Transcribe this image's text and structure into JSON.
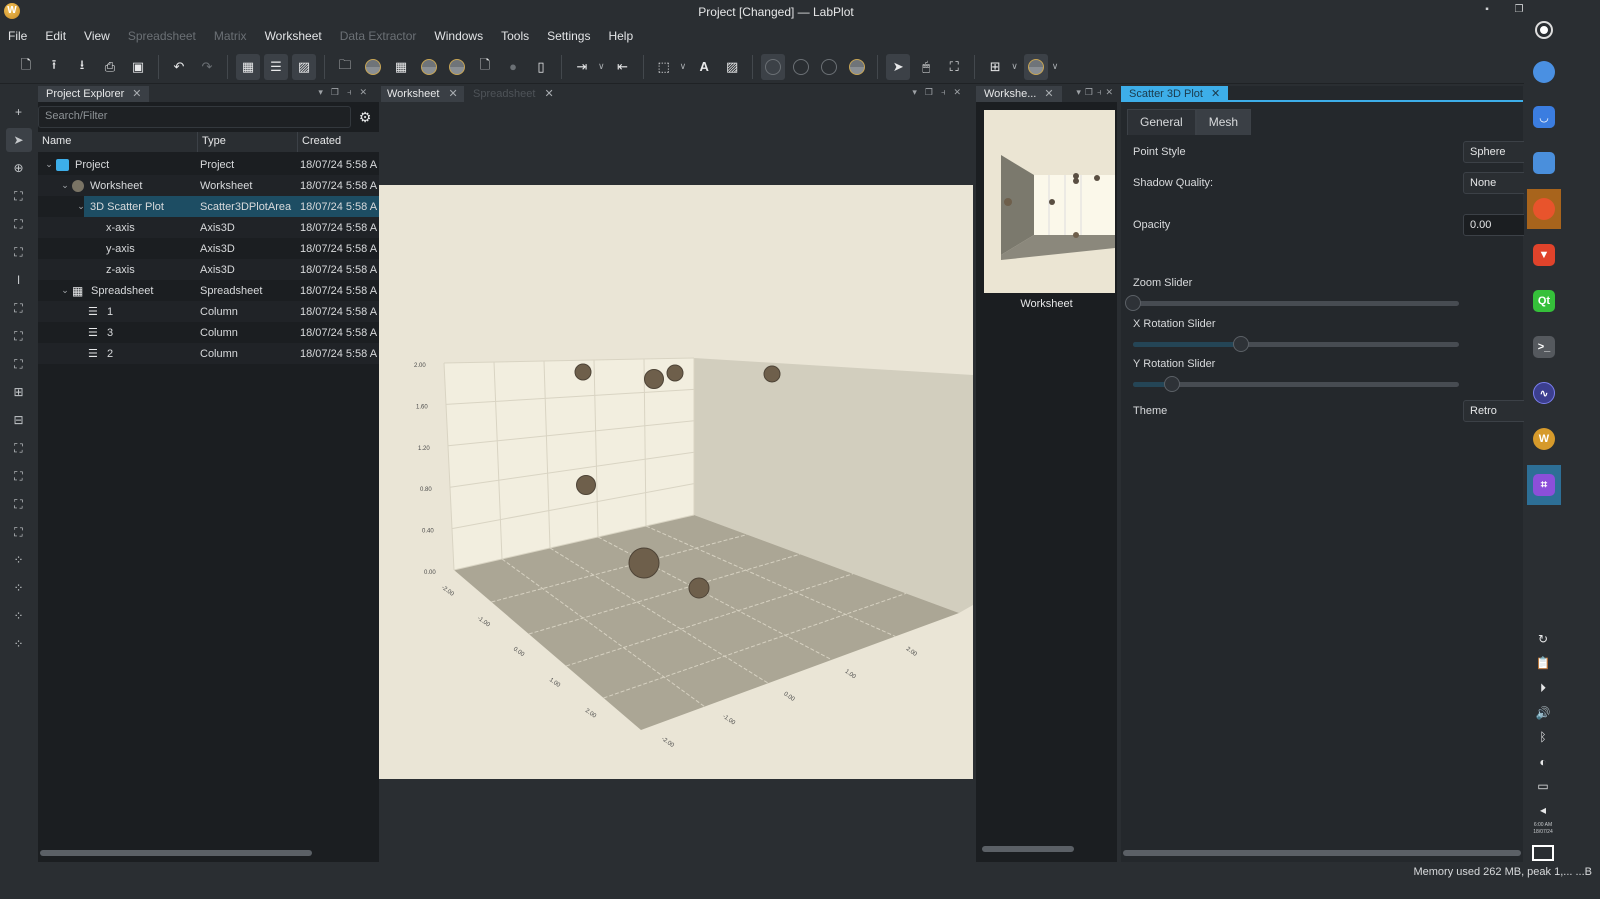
{
  "window": {
    "title": "Project [Changed] — LabPlot",
    "app_icon": "labplot-logo"
  },
  "menu": [
    {
      "label": "File",
      "enabled": true
    },
    {
      "label": "Edit",
      "enabled": true
    },
    {
      "label": "View",
      "enabled": true
    },
    {
      "label": "Spreadsheet",
      "enabled": false
    },
    {
      "label": "Matrix",
      "enabled": false
    },
    {
      "label": "Worksheet",
      "enabled": true
    },
    {
      "label": "Data Extractor",
      "enabled": false
    },
    {
      "label": "Windows",
      "enabled": true
    },
    {
      "label": "Tools",
      "enabled": true
    },
    {
      "label": "Settings",
      "enabled": true
    },
    {
      "label": "Help",
      "enabled": true
    }
  ],
  "toolbar": {
    "icons": [
      "new-document-icon",
      "import-icon",
      "export-icon",
      "print-icon",
      "archive-icon",
      "undo-icon",
      "redo-icon",
      "grid-view-icon",
      "list-view-icon",
      "image-view-icon",
      "open-folder-icon",
      "worksheet-icon",
      "spreadsheet-add-icon",
      "worksheet-icon",
      "worksheet-icon",
      "add-note-icon",
      "drop-icon",
      "page-icon",
      "export-layout-icon",
      "layout-icon",
      "plot-area-icon",
      "text-label-icon",
      "image-icon",
      "plot-type-icon",
      "plot-type-icon",
      "plot-type-icon",
      "plot-type-icon",
      "select-cursor-icon",
      "mouse-mode-icon",
      "fit-icon",
      "add-element-icon",
      "worksheet-theme-icon"
    ]
  },
  "project_explorer": {
    "title": "Project Explorer",
    "search_placeholder": "Search/Filter",
    "columns": [
      "Name",
      "Type",
      "Created"
    ],
    "rows": [
      {
        "name": "Project",
        "type": "Project",
        "created": "18/07/24 5:58 A",
        "icon": "folder-icon",
        "level": 0,
        "expanded": true
      },
      {
        "name": "Worksheet",
        "type": "Worksheet",
        "created": "18/07/24 5:58 A",
        "icon": "worksheet-icon",
        "level": 1,
        "expanded": true
      },
      {
        "name": "3D Scatter Plot",
        "type": "Scatter3DPlotArea",
        "created": "18/07/24 5:58 A",
        "icon": "",
        "level": 2,
        "expanded": true,
        "selected": true
      },
      {
        "name": "x-axis",
        "type": "Axis3D",
        "created": "18/07/24 5:58 A",
        "icon": "",
        "level": 3
      },
      {
        "name": "y-axis",
        "type": "Axis3D",
        "created": "18/07/24 5:58 A",
        "icon": "",
        "level": 3
      },
      {
        "name": "z-axis",
        "type": "Axis3D",
        "created": "18/07/24 5:58 A",
        "icon": "",
        "level": 3
      },
      {
        "name": "Spreadsheet",
        "type": "Spreadsheet",
        "created": "18/07/24 5:58 A",
        "icon": "spreadsheet-icon",
        "level": 1,
        "expanded": true
      },
      {
        "name": "1",
        "type": "Column",
        "created": "18/07/24 5:58 A",
        "icon": "column-icon",
        "level": 2
      },
      {
        "name": "3",
        "type": "Column",
        "created": "18/07/24 5:58 A",
        "icon": "column-icon",
        "level": 2
      },
      {
        "name": "2",
        "type": "Column",
        "created": "18/07/24 5:58 A",
        "icon": "column-icon",
        "level": 2
      }
    ]
  },
  "center_tabs": [
    {
      "label": "Worksheet",
      "active": true
    },
    {
      "label": "Spreadsheet",
      "active": false
    }
  ],
  "plot": {
    "y_tick_labels": [
      "2.00",
      "1.60",
      "1.20",
      "0.80",
      "0.40",
      "0.00"
    ],
    "x_tick_labels": [
      "-2.00",
      "-1.00",
      "0.00",
      "1.00",
      "2.00"
    ],
    "z_tick_labels": [
      "-2.00",
      "-1.00",
      "0.00",
      "1.00",
      "2.00"
    ],
    "background_color": "#eae5d6",
    "point_color": "#6e5f4b"
  },
  "preview": {
    "tab_label": "Workshe...",
    "caption": "Worksheet"
  },
  "properties": {
    "tab_label": "Scatter 3D Plot",
    "subtabs": [
      {
        "label": "General",
        "active": false
      },
      {
        "label": "Mesh",
        "active": true
      }
    ],
    "point_style": {
      "label": "Point Style",
      "value": "Sphere"
    },
    "shadow_quality": {
      "label": "Shadow Quality:",
      "value": "None"
    },
    "opacity": {
      "label": "Opacity",
      "value": "0.00"
    },
    "zoom_slider": {
      "label": "Zoom Slider",
      "value": 0.0
    },
    "x_rotation_slider": {
      "label": "X Rotation Slider",
      "value": 0.33
    },
    "y_rotation_slider": {
      "label": "Y Rotation Slider",
      "value": 0.12
    },
    "theme": {
      "label": "Theme",
      "value": "Retro"
    }
  },
  "taskbar": {
    "apps": [
      "obs-icon",
      "toggle-icon",
      "store-icon",
      "files-icon",
      "firefox-icon",
      "brave-icon",
      "qt-creator-icon",
      "terminal-icon",
      "monitor-icon",
      "labplot-icon",
      "screenshot-icon"
    ],
    "tray": [
      "refresh-icon",
      "clipboard-icon",
      "media-play-icon",
      "volume-icon",
      "bluetooth-icon",
      "brightness-icon",
      "display-icon",
      "expand-tray-icon"
    ],
    "clock_time": "6:00 AM",
    "clock_date": "18/07/24"
  },
  "status": {
    "text": "Memory used 262 MB, peak 1,... ...B"
  }
}
